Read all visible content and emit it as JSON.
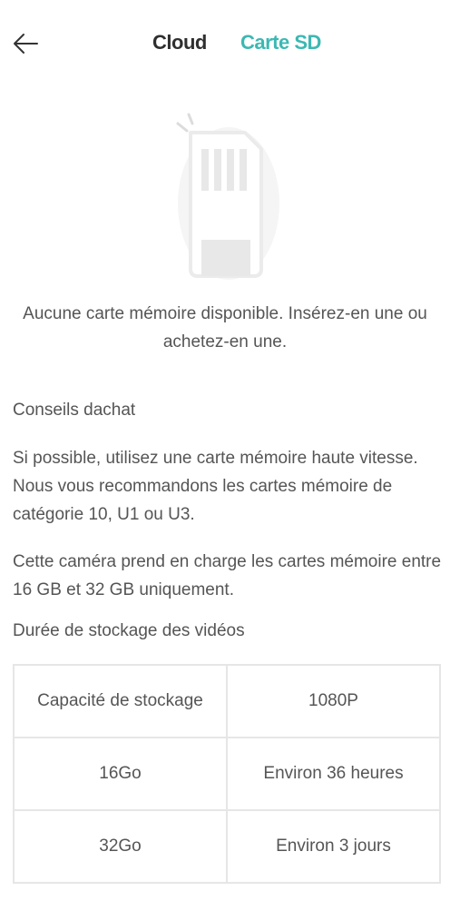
{
  "header": {
    "back_icon": "arrow-left-icon",
    "tabs": [
      {
        "label": "Cloud",
        "active": false
      },
      {
        "label": "Carte SD",
        "active": true
      }
    ],
    "accent_color": "#3cb8b2"
  },
  "illustration": {
    "icon": "sd-card-icon"
  },
  "empty_state": {
    "message": "Aucune carte mémoire disponible. Insérez-en une ou achetez-en une."
  },
  "advice": {
    "title": "Conseils dachat",
    "speed_tip": "Si possible, utilisez une carte mémoire haute vitesse. Nous vous recommandons les cartes mémoire de catégorie 10, U1 ou U3.",
    "capacity_tip": "Cette caméra prend en charge les cartes mémoire entre 16 GB et 32 GB uniquement."
  },
  "storage": {
    "title": "Durée de stockage des vidéos",
    "headers": [
      "Capacité de stockage",
      "1080P"
    ],
    "rows": [
      [
        "16Go",
        "Environ 36 heures"
      ],
      [
        "32Go",
        "Environ 3 jours"
      ]
    ]
  }
}
